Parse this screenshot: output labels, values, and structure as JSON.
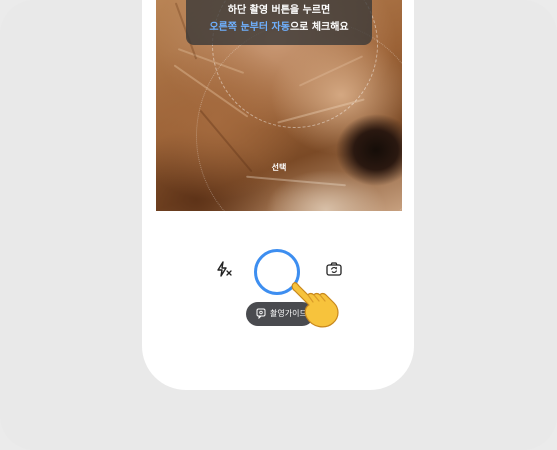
{
  "camera": {
    "instruction_line1": "하단 촬영 버튼을 누르면",
    "instruction_highlight": "오른쪽 눈부터 자동",
    "instruction_rest": "으로 체크해요",
    "select_label": "선택"
  },
  "controls": {
    "flash_icon": "flash-off-icon",
    "shutter_icon": "shutter-ring",
    "switch_icon": "switch-camera-icon",
    "guide_label": "촬영가이드"
  },
  "colors": {
    "accent": "#3d8ef0",
    "highlight_text": "#6fb1ff",
    "overlay_bg": "#373737",
    "pill_bg": "#4a4b4f",
    "page_bg": "#e9e9e9"
  }
}
